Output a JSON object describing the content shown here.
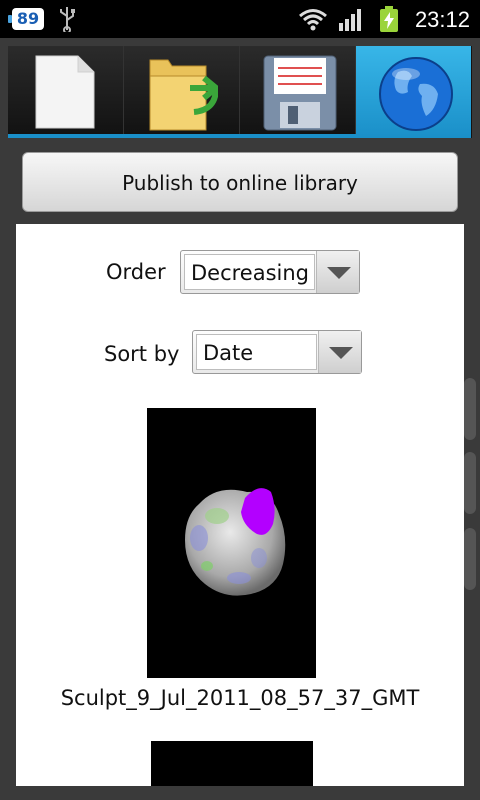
{
  "status_bar": {
    "battery_badge": "89",
    "time": "23:12",
    "icons": [
      "battery-badge-icon",
      "usb-icon",
      "wifi-icon",
      "signal-icon",
      "battery-charging-icon"
    ]
  },
  "tabs": [
    {
      "name": "new",
      "icon": "document-icon"
    },
    {
      "name": "open",
      "icon": "folder-open-icon"
    },
    {
      "name": "save",
      "icon": "floppy-disk-icon"
    },
    {
      "name": "online",
      "icon": "globe-icon",
      "active": true
    }
  ],
  "publish_button_label": "Publish to online library",
  "order": {
    "label": "Order",
    "value": "Decreasing"
  },
  "sort_by": {
    "label": "Sort by",
    "value": "Date"
  },
  "items": [
    {
      "caption": "Sculpt_9_Jul_2011_08_57_37_GMT"
    }
  ],
  "colors": {
    "accent": "#1a8fc8",
    "status_bar": "#000000",
    "background": "#3a3a3a"
  }
}
